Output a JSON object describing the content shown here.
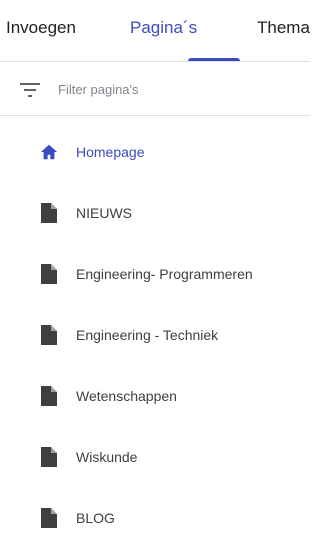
{
  "tabs": [
    {
      "label": "Invoegen",
      "active": false
    },
    {
      "label": "Pagina´s",
      "active": true
    },
    {
      "label": "Thema",
      "active": false
    }
  ],
  "filter": {
    "placeholder": "Filter pagina's",
    "icon": "filter-list-icon"
  },
  "pages": [
    {
      "label": "Homepage",
      "icon": "home-icon",
      "active": true
    },
    {
      "label": "NIEUWS",
      "icon": "page-icon",
      "active": false
    },
    {
      "label": "Engineering- Programmeren",
      "icon": "page-icon",
      "active": false
    },
    {
      "label": "Engineering - Techniek",
      "icon": "page-icon",
      "active": false
    },
    {
      "label": "Wetenschappen",
      "icon": "page-icon",
      "active": false
    },
    {
      "label": "Wiskunde",
      "icon": "page-icon",
      "active": false
    },
    {
      "label": "BLOG",
      "icon": "page-icon",
      "active": false
    }
  ],
  "colors": {
    "accent": "#3c4bbd",
    "icon": "#3c4043",
    "divider": "#e0e0e0"
  }
}
